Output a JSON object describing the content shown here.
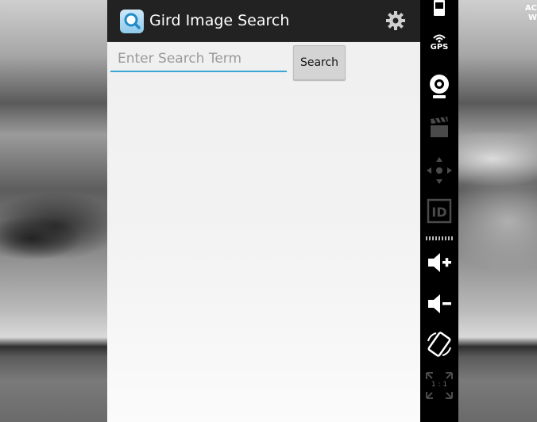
{
  "app": {
    "title": "Gird Image Search",
    "icons": {
      "app": "search-magnifier-icon",
      "settings": "gear-icon"
    }
  },
  "search": {
    "placeholder": "Enter Search Term",
    "value": "",
    "button_label": "Search"
  },
  "emulator_toolbar": {
    "gps_label": "GPS",
    "scale_label": "1 : 1",
    "buttons": [
      "battery-icon",
      "gps-icon",
      "camera-icon",
      "video-clapper-icon",
      "dpad-icon",
      "device-id-icon",
      "volume-up-icon",
      "volume-down-icon",
      "rotate-icon",
      "scale-icon"
    ]
  },
  "desktop": {
    "corner_text_line1": "AC",
    "corner_text_line2": "W"
  },
  "colors": {
    "action_bar": "#222222",
    "input_underline": "#39a6d8",
    "button_bg": "#d4d4d4",
    "toolbar_bg": "#000000"
  }
}
